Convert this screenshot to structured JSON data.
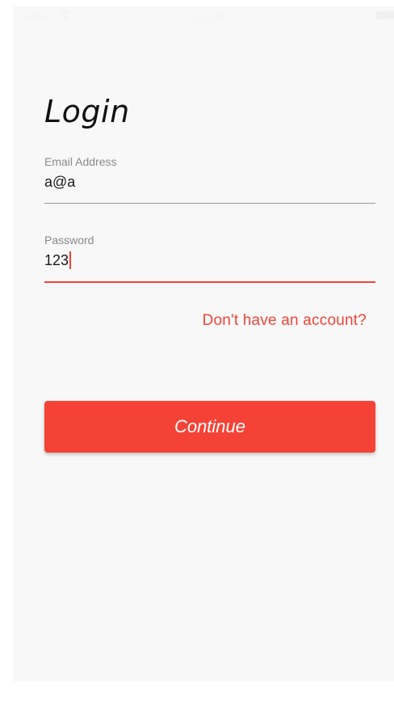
{
  "status_bar": {
    "carrier": "Carrier",
    "time": "12:18 AM",
    "wifi_icon": "wifi-icon",
    "battery_icon": "battery-icon"
  },
  "page": {
    "title": "Login"
  },
  "email": {
    "label": "Email Address",
    "value": "a@a"
  },
  "password": {
    "label": "Password",
    "value": "123"
  },
  "signup_link": "Don't have an account?",
  "continue_button": "Continue",
  "colors": {
    "accent": "#f44336",
    "background": "#f8f8f8",
    "divider": "#9a9a9a"
  }
}
